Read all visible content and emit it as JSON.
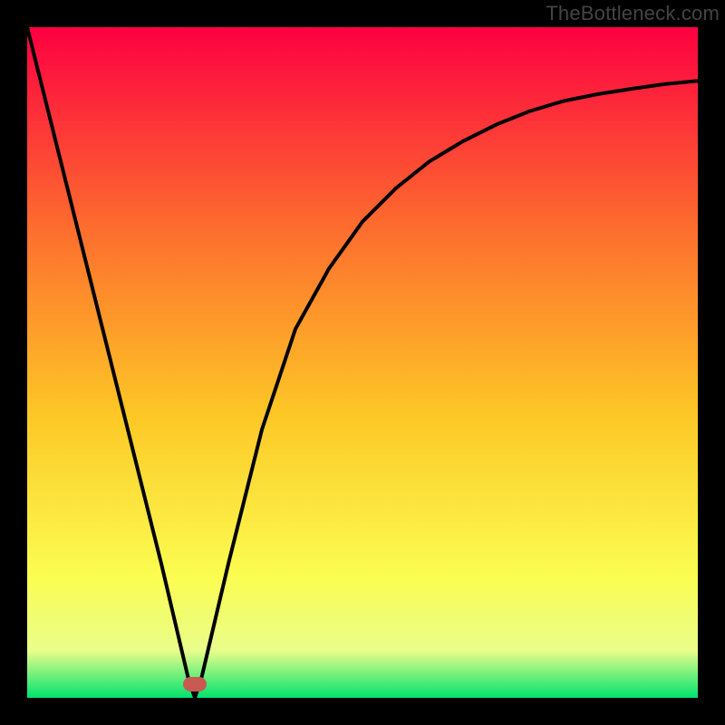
{
  "attribution": "TheBottleneck.com",
  "chart_data": {
    "type": "line",
    "title": "",
    "xlabel": "",
    "ylabel": "",
    "xlim": [
      0,
      100
    ],
    "ylim": [
      0,
      100
    ],
    "x": [
      0,
      5,
      10,
      15,
      20,
      24,
      25,
      26,
      30,
      35,
      40,
      45,
      50,
      55,
      60,
      65,
      70,
      75,
      80,
      85,
      90,
      95,
      100
    ],
    "values": [
      100,
      80,
      60,
      40,
      20,
      3,
      0,
      3,
      20,
      40,
      55,
      64,
      71,
      76,
      80,
      83,
      85.5,
      87.5,
      89,
      90,
      90.8,
      91.5,
      92
    ],
    "marker": {
      "x": 25,
      "y": 2
    },
    "colors": {
      "gradient_top": "#fd0041",
      "gradient_mid_upper": "#fd6d2e",
      "gradient_mid": "#fdc826",
      "gradient_mid_lower": "#fbfd51",
      "gradient_lower": "#e9fd8a",
      "gradient_bottom": "#00e36e",
      "curve": "#000000",
      "marker": "#c85a52"
    }
  }
}
